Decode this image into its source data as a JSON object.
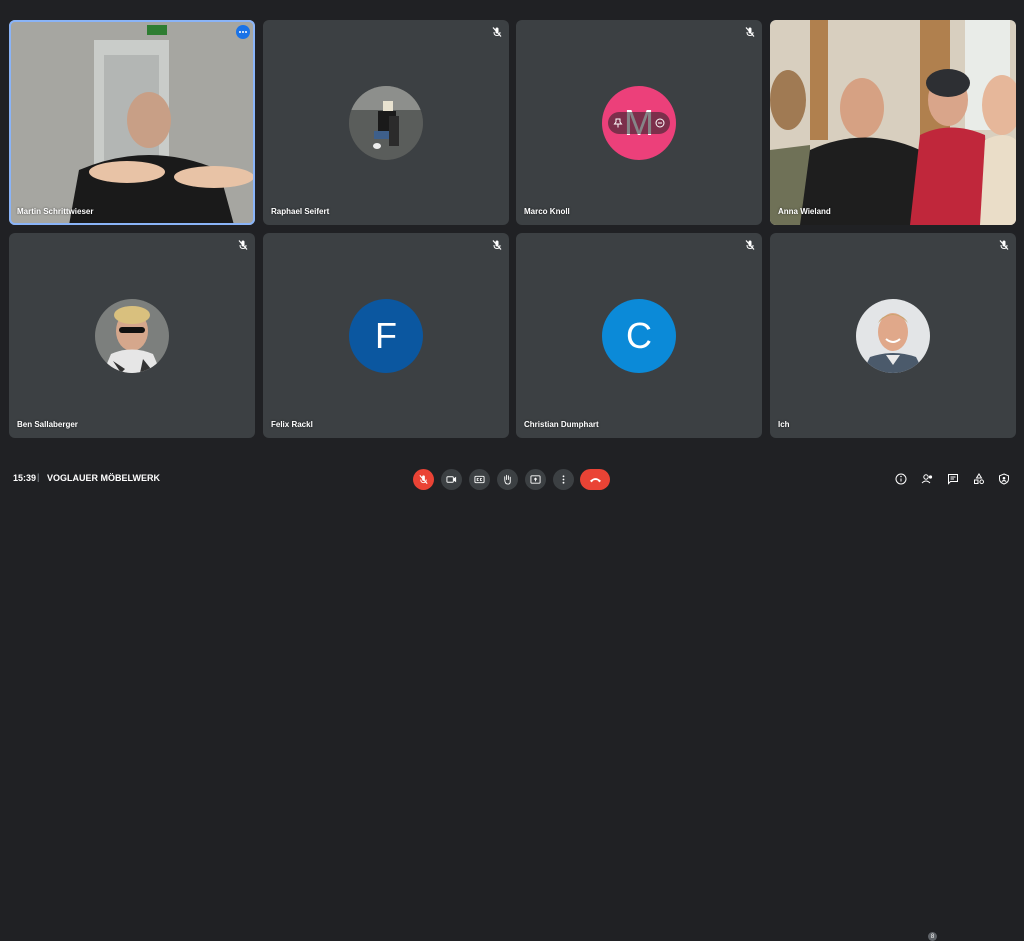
{
  "participants": [
    {
      "name": "Martin Schrittwieser",
      "video": true,
      "speaking": true
    },
    {
      "name": "Raphael Seifert",
      "muted": true
    },
    {
      "name": "Marco Knoll",
      "muted": true,
      "initial": "M",
      "avatar_color": "#ec407a"
    },
    {
      "name": "Anna Wieland",
      "video": true
    },
    {
      "name": "Ben Sallaberger",
      "muted": true
    },
    {
      "name": "Felix Rackl",
      "muted": true,
      "initial": "F",
      "avatar_color": "#0b57a0"
    },
    {
      "name": "Christian Dumphart",
      "muted": true,
      "initial": "C",
      "avatar_color": "#0b8ad8"
    },
    {
      "name": "Ich",
      "muted": true
    }
  ],
  "bottom_bar": {
    "time": "15:39",
    "separator": "|",
    "meeting_title": "VOGLAUER MÖBELWERK",
    "participant_count": "8"
  },
  "controls": {
    "mic_state": "muted",
    "buttons": [
      "mic-off-icon",
      "camera-icon",
      "captions-icon",
      "raise-hand-icon",
      "present-icon",
      "more-icon",
      "end-call-icon"
    ],
    "right_icons": [
      "info-icon",
      "people-icon",
      "chat-icon",
      "activities-icon",
      "host-controls-icon"
    ]
  },
  "colors": {
    "background": "#202124",
    "tile": "#3c4043",
    "accent": "#1a73e8",
    "danger": "#ea4335"
  }
}
